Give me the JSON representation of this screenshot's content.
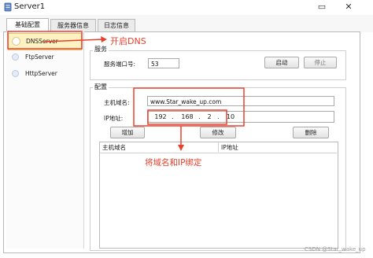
{
  "window": {
    "title": "Server1",
    "minimize_glyph": "▭",
    "close_glyph": "✕"
  },
  "tabs": [
    {
      "label": "基础配置"
    },
    {
      "label": "服务器信息"
    },
    {
      "label": "日志信息"
    }
  ],
  "sidebar": {
    "items": [
      {
        "label": "DNSServer",
        "selected": true
      },
      {
        "label": "FtpServer",
        "selected": false
      },
      {
        "label": "HttpServer",
        "selected": false
      }
    ]
  },
  "service_group": {
    "title": "服务",
    "port_label": "服务端口号:",
    "port_value": "53",
    "start_button": "启动",
    "stop_button": "停止"
  },
  "config_group": {
    "title": "配置",
    "hostname_label": "主机域名:",
    "hostname_value": "www.Star_wake_up.com",
    "ip_label": "IP地址:",
    "ip_segments": [
      "192",
      "168",
      "2",
      "10"
    ],
    "add_button": "增加",
    "modify_button": "修改",
    "delete_button": "删除",
    "table_headers": [
      "主机域名",
      "IP地址"
    ]
  },
  "annotations": {
    "open_dns": "开启DNS",
    "bind_note": "将域名和IP绑定",
    "color": "#e8402c"
  },
  "watermark": "CSDN @Star_wake_up"
}
